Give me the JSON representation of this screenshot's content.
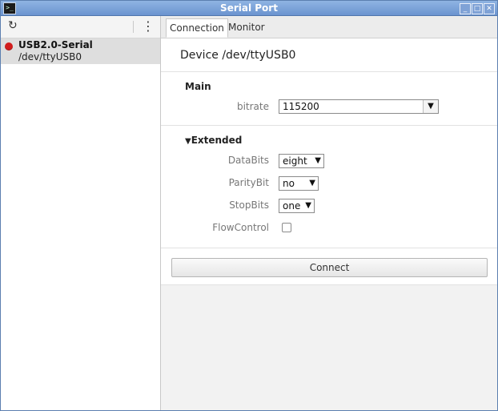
{
  "window": {
    "title": "Serial Port",
    "controls": [
      "_",
      "□",
      "✕"
    ]
  },
  "sidebar": {
    "device": {
      "name": "USB2.0-Serial",
      "path": "/dev/ttyUSB0",
      "status_color": "#d21d1d"
    }
  },
  "tabs": [
    {
      "label": "Connection"
    },
    {
      "label": "Monitor"
    }
  ],
  "connection": {
    "device_title": "Device /dev/ttyUSB0",
    "main": {
      "title": "Main",
      "bitrate": {
        "label": "bitrate",
        "value": "115200"
      }
    },
    "extended": {
      "title": "Extended",
      "toggle": "▼",
      "databits": {
        "label": "DataBits",
        "value": "eight"
      },
      "paritybit": {
        "label": "ParityBit",
        "value": "no"
      },
      "stopbits": {
        "label": "StopBits",
        "value": "one"
      },
      "flowcontrol": {
        "label": "FlowControl",
        "checked": false
      }
    },
    "connect_label": "Connect"
  },
  "colors": {
    "titlebar": "#7aa0d8",
    "accent_red": "#d21d1d"
  }
}
